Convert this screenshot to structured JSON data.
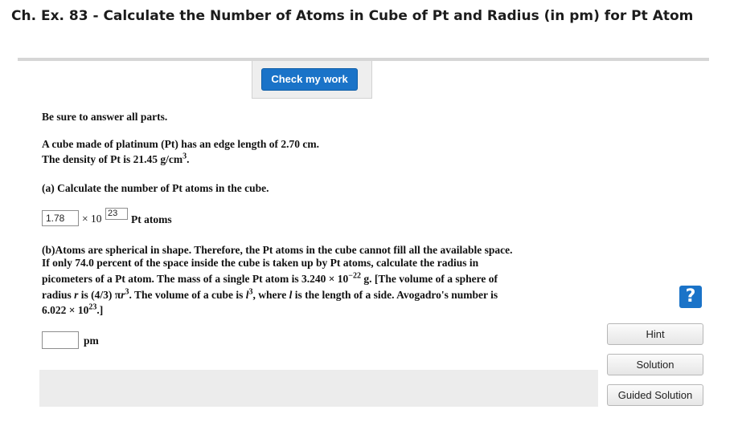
{
  "header": {
    "title": "Ch. Ex. 83 - Calculate the Number of Atoms in Cube of Pt and Radius (in pm) for Pt Atom"
  },
  "toolbar": {
    "check_label": "Check my work"
  },
  "question": {
    "instruction": "Be sure to answer all parts.",
    "intro_line1": "A cube made of platinum (Pt) has an edge length of 2.70 cm.",
    "intro_line2_prefix": "The density of Pt is 21.45 g/cm",
    "intro_line2_sup": "3",
    "intro_line2_suffix": ".",
    "part_a": "(a) Calculate the number of Pt atoms in the cube.",
    "part_a_answer": {
      "value": "1.78",
      "times": "× 10",
      "exponent": "23",
      "unit": "Pt atoms"
    },
    "part_b": {
      "line1": "(b)Atoms are spherical in shape. Therefore, the Pt atoms in the cube cannot fill all the available space.",
      "line2": "If only 74.0 percent of the space inside the cube is taken up by Pt atoms, calculate the radius in",
      "line3_prefix": "picometers of a Pt atom. The mass of a single Pt atom is 3.240 × 10",
      "line3_sup": "−22",
      "line3_suffix": " g. [The volume of a sphere of",
      "line4_a": "radius ",
      "line4_r": "r",
      "line4_b": " is (4/3) π",
      "line4_r2": "r",
      "line4_sup": "3",
      "line4_c": ". The volume of a cube is ",
      "line4_l": "l",
      "line4_sup2": "3",
      "line4_d": ", where ",
      "line4_l2": "l",
      "line4_e": " is the length of a side. Avogadro's number is",
      "line5_prefix": "6.022 × 10",
      "line5_sup": "23",
      "line5_suffix": ".]"
    },
    "part_b_answer": {
      "value": "",
      "unit": "pm"
    }
  },
  "sidebar": {
    "help_icon_glyph": "?",
    "hint_label": "Hint",
    "solution_label": "Solution",
    "guided_solution_label": "Guided Solution"
  },
  "colors": {
    "accent": "#1a73c8",
    "panel": "#ececec"
  },
  "icons": {
    "help": "question-mark-icon"
  }
}
